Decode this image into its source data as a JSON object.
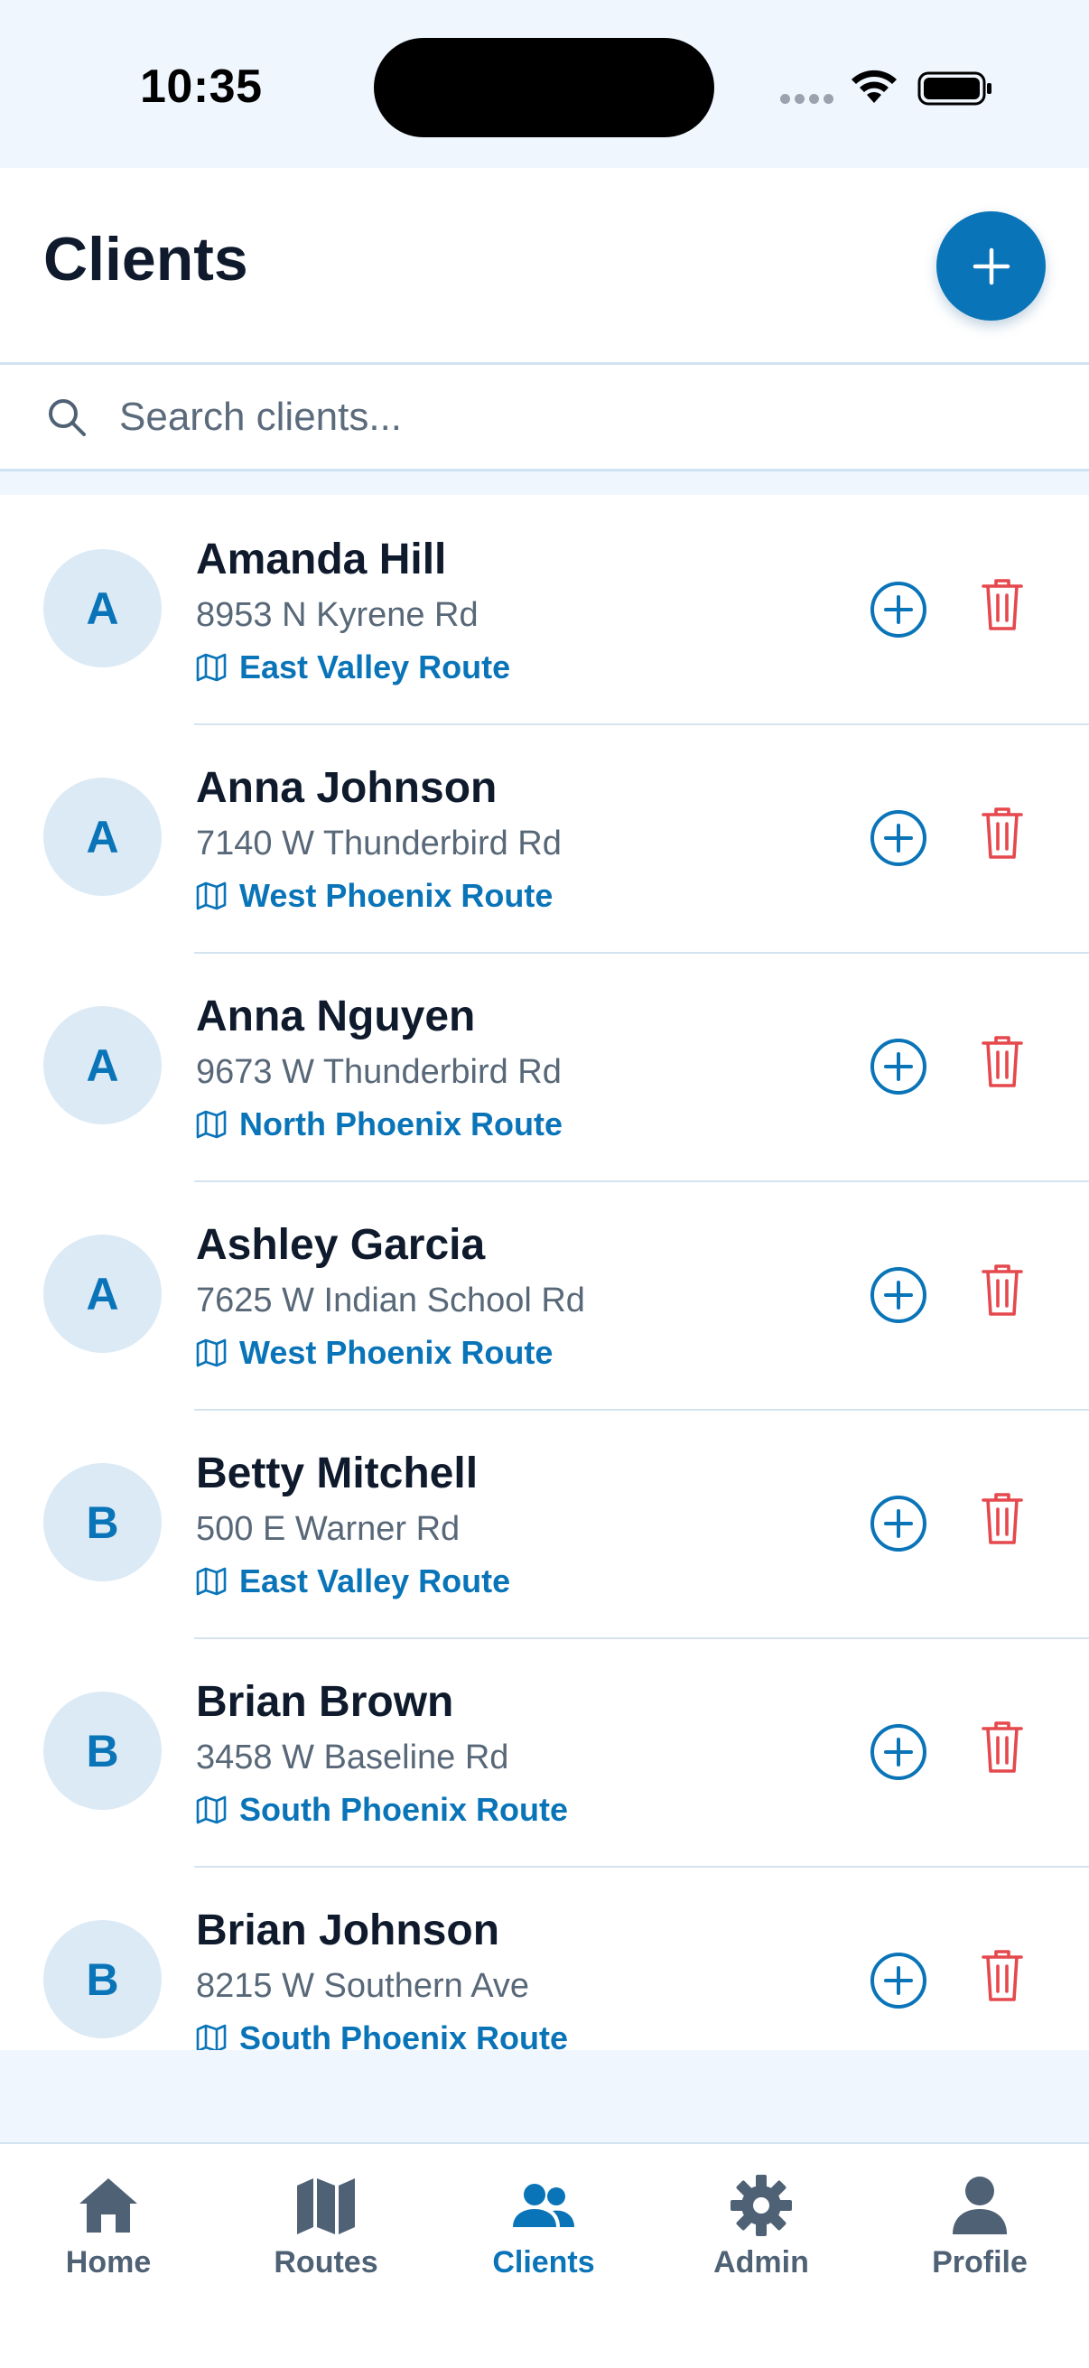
{
  "status_bar": {
    "time": "10:35"
  },
  "header": {
    "title": "Clients",
    "add_button_icon": "plus-icon"
  },
  "search": {
    "placeholder": "Search clients...",
    "value": ""
  },
  "clients": [
    {
      "initial": "A",
      "name": "Amanda Hill",
      "address": "8953 N Kyrene Rd",
      "route": "East Valley Route"
    },
    {
      "initial": "A",
      "name": "Anna Johnson",
      "address": "7140 W Thunderbird Rd",
      "route": "West Phoenix Route"
    },
    {
      "initial": "A",
      "name": "Anna Nguyen",
      "address": "9673 W Thunderbird Rd",
      "route": "North Phoenix Route"
    },
    {
      "initial": "A",
      "name": "Ashley Garcia",
      "address": "7625 W Indian School Rd",
      "route": "West Phoenix Route"
    },
    {
      "initial": "B",
      "name": "Betty Mitchell",
      "address": "500 E Warner Rd",
      "route": "East Valley Route"
    },
    {
      "initial": "B",
      "name": "Brian Brown",
      "address": "3458 W Baseline Rd",
      "route": "South Phoenix Route"
    },
    {
      "initial": "B",
      "name": "Brian Johnson",
      "address": "8215 W Southern Ave",
      "route": "South Phoenix Route"
    }
  ],
  "tabs": [
    {
      "label": "Home",
      "icon": "home-icon",
      "active": false
    },
    {
      "label": "Routes",
      "icon": "map-icon",
      "active": false
    },
    {
      "label": "Clients",
      "icon": "users-icon",
      "active": true
    },
    {
      "label": "Admin",
      "icon": "gear-icon",
      "active": false
    },
    {
      "label": "Profile",
      "icon": "user-icon",
      "active": false
    }
  ],
  "colors": {
    "accent": "#0a74b8",
    "delete": "#e5484d",
    "background": "#eff6fe",
    "tab_inactive": "#4f6275"
  }
}
